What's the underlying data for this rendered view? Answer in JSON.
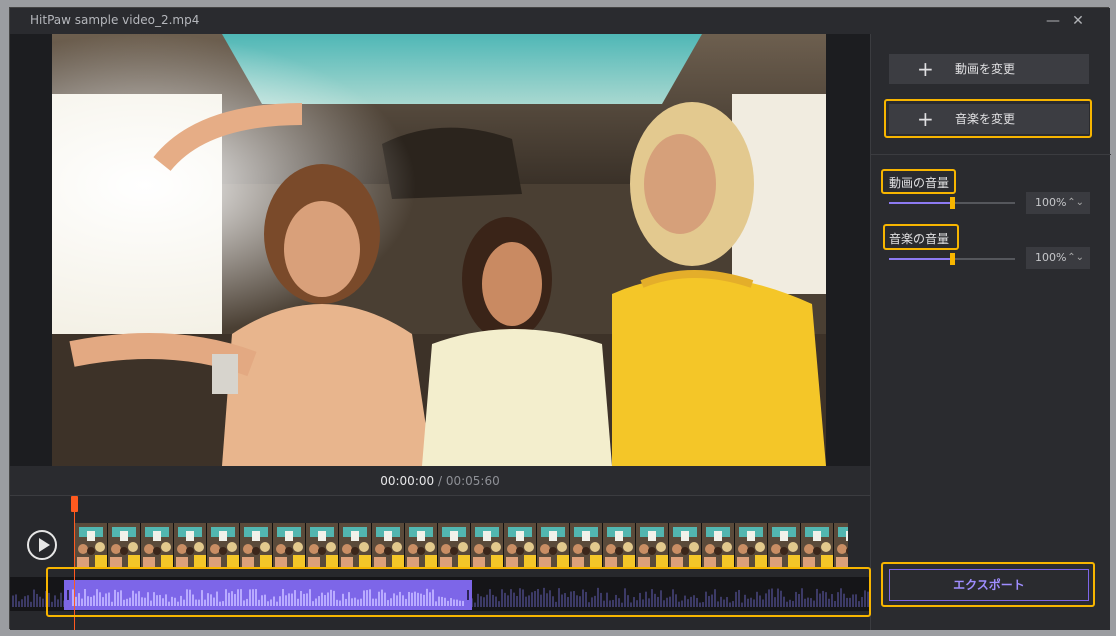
{
  "window": {
    "title": "HitPaw sample video_2.mp4",
    "minimize_glyph": "—",
    "close_glyph": "✕"
  },
  "player": {
    "current_time": "00:00:00",
    "separator": "/",
    "duration": "00:05:60"
  },
  "sidebar": {
    "change_video_label": "動画を変更",
    "change_music_label": "音楽を変更",
    "plus_glyph": "+",
    "video_volume": {
      "label": "動画の音量",
      "value": "100%",
      "level": 0.5
    },
    "music_volume": {
      "label": "音楽の音量",
      "value": "100%",
      "level": 0.5
    },
    "export_label": "エクスポート"
  },
  "colors": {
    "accent": "#7d66e8",
    "highlight": "#f7b500",
    "playhead": "#ff5a1f",
    "background": "#2a2b2f"
  },
  "icons": {
    "play": "play-icon",
    "plus": "plus-icon",
    "stepper": "stepper-icon"
  }
}
